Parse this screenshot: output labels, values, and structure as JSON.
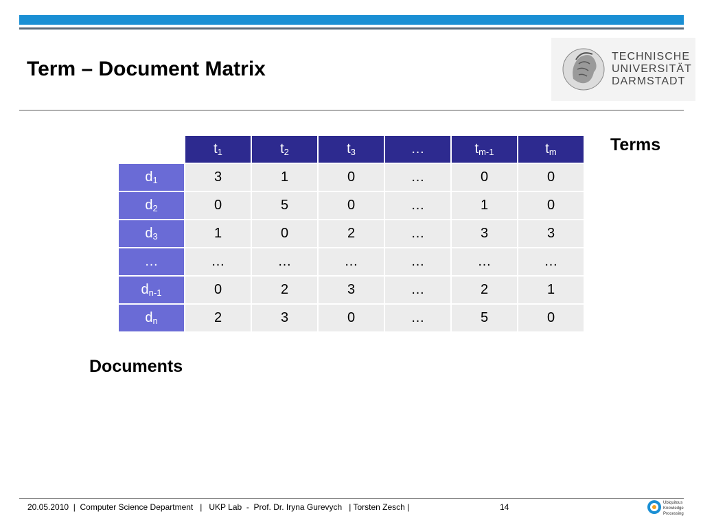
{
  "slide": {
    "title": "Term – Document Matrix",
    "terms_label": "Terms",
    "documents_label": "Documents"
  },
  "logo": {
    "line1": "TECHNISCHE",
    "line2": "UNIVERSITÄT",
    "line3": "DARMSTADT"
  },
  "matrix": {
    "columns": [
      {
        "base": "t",
        "sub": "1"
      },
      {
        "base": "t",
        "sub": "2"
      },
      {
        "base": "t",
        "sub": "3"
      },
      {
        "base": "…",
        "sub": ""
      },
      {
        "base": "t",
        "sub": "m-1"
      },
      {
        "base": "t",
        "sub": "m"
      }
    ],
    "rows": [
      {
        "base": "d",
        "sub": "1",
        "cells": [
          "3",
          "1",
          "0",
          "…",
          "0",
          "0"
        ]
      },
      {
        "base": "d",
        "sub": "2",
        "cells": [
          "0",
          "5",
          "0",
          "…",
          "1",
          "0"
        ]
      },
      {
        "base": "d",
        "sub": "3",
        "cells": [
          "1",
          "0",
          "2",
          "…",
          "3",
          "3"
        ]
      },
      {
        "base": "…",
        "sub": "",
        "cells": [
          "…",
          "…",
          "…",
          "…",
          "…",
          "…"
        ]
      },
      {
        "base": "d",
        "sub": "n-1",
        "cells": [
          "0",
          "2",
          "3",
          "…",
          "2",
          "1"
        ]
      },
      {
        "base": "d",
        "sub": "n",
        "cells": [
          "2",
          "3",
          "0",
          "…",
          "5",
          "0"
        ]
      }
    ]
  },
  "footer": {
    "text": "20.05.2010  |  Computer Science Department   |   UKP Lab  -  Prof. Dr. Iryna Gurevych   | Torsten Zesch |",
    "page": "14",
    "ukp_line1": "Ubiquitous",
    "ukp_line2": "Knowledge",
    "ukp_line3": "Processing"
  },
  "colors": {
    "top_bar": "#1a8fd4",
    "column_header": "#2d2a8f",
    "row_header": "#6a6bd6",
    "cell": "#ececec"
  }
}
